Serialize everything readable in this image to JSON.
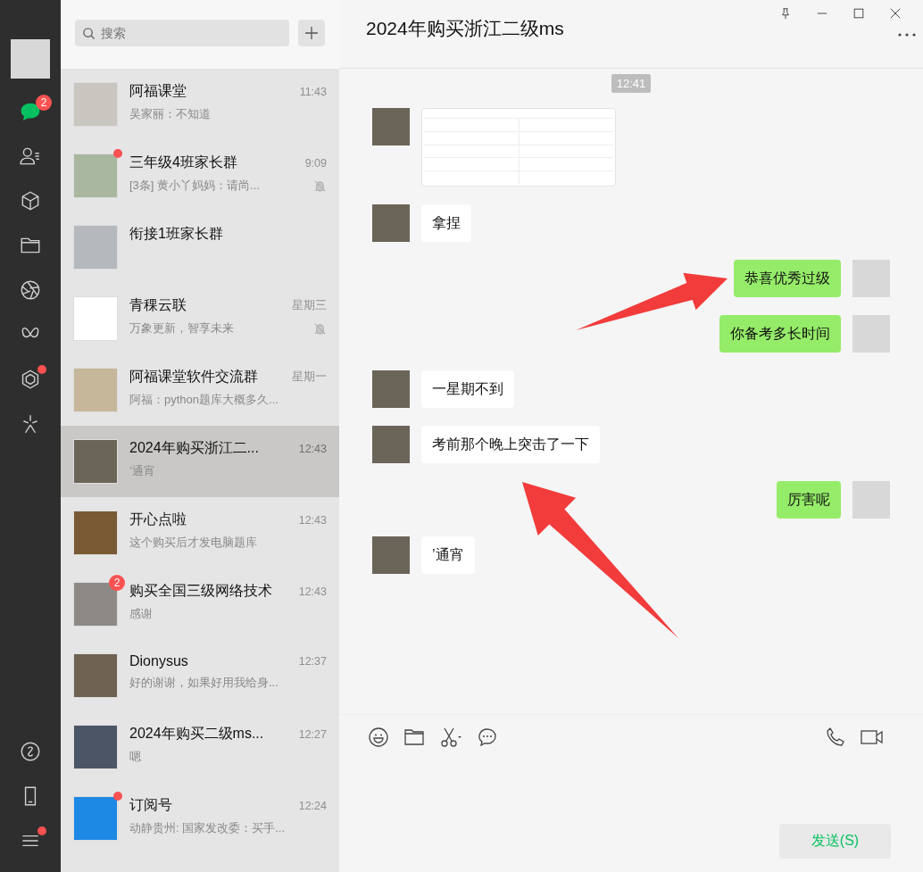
{
  "nav": {
    "top": [
      {
        "selected": true,
        "badge": "2",
        "dot": false
      },
      {
        "selected": false,
        "dot": false
      },
      {
        "selected": false,
        "dot": false
      },
      {
        "selected": false,
        "dot": false
      },
      {
        "selected": false,
        "dot": false
      },
      {
        "selected": false,
        "dot": false
      },
      {
        "selected": false,
        "dot": true
      },
      {
        "selected": false,
        "dot": false
      }
    ],
    "menu_dot": true
  },
  "search": {
    "placeholder": "搜索"
  },
  "chats": [
    {
      "name": "阿福课堂",
      "time": "11:43",
      "preview": "吴家丽：不知道",
      "selected": false,
      "muted": false,
      "dot": false
    },
    {
      "name": "三年级4班家长群",
      "time": "9:09",
      "preview": "[3条] 黄小丫妈妈：请尚...",
      "selected": false,
      "muted": true,
      "dot": true
    },
    {
      "name": "衔接1班家长群",
      "selected": false,
      "muted": false,
      "dot": false
    },
    {
      "name": "青稞云联",
      "time": "星期三",
      "preview": "万象更新，智享未来",
      "selected": false,
      "muted": true,
      "dot": false
    },
    {
      "name": "阿福课堂软件交流群",
      "time": "星期一",
      "preview": "阿福：python题库大概多久...",
      "selected": false,
      "muted": false,
      "dot": false
    },
    {
      "name": "2024年购买浙江二...",
      "time": "12:43",
      "preview": "’通宵",
      "selected": true,
      "muted": false,
      "dot": false
    },
    {
      "name": "开心点啦",
      "time": "12:43",
      "preview": "这个购买后才发电脑题库",
      "selected": false,
      "muted": false,
      "dot": false
    },
    {
      "name": "购买全国三级网络技术",
      "time": "12:43",
      "preview": "感谢",
      "selected": false,
      "muted": false,
      "dot": false,
      "badge": "2"
    },
    {
      "name": "Dionysus",
      "time": "12:37",
      "preview": "好的谢谢，如果好用我给身...",
      "selected": false,
      "muted": false,
      "dot": false
    },
    {
      "name": "2024年购买二级ms...",
      "time": "12:27",
      "preview": "嗯",
      "selected": false,
      "muted": false,
      "dot": false
    },
    {
      "name": "订阅号",
      "time": "12:24",
      "preview": "动静贵州: 国家发改委：买手...",
      "selected": false,
      "muted": false,
      "dot": true
    }
  ],
  "conversation": {
    "title": "2024年购买浙江二级ms",
    "messages": [
      {
        "kind": "time",
        "text": "12:41"
      },
      {
        "kind": "image",
        "outgoing": false
      },
      {
        "kind": "text",
        "outgoing": false,
        "text": "拿捏"
      },
      {
        "kind": "text",
        "outgoing": true,
        "text": "恭喜优秀过级"
      },
      {
        "kind": "text",
        "outgoing": true,
        "text": "你备考多长时间"
      },
      {
        "kind": "text",
        "outgoing": false,
        "text": "一星期不到"
      },
      {
        "kind": "text",
        "outgoing": false,
        "text": "考前那个晚上突击了一下"
      },
      {
        "kind": "text",
        "outgoing": true,
        "text": "厉害呢"
      },
      {
        "kind": "text",
        "outgoing": false,
        "text": "’通宵"
      }
    ]
  },
  "send_button": "发送(S)"
}
